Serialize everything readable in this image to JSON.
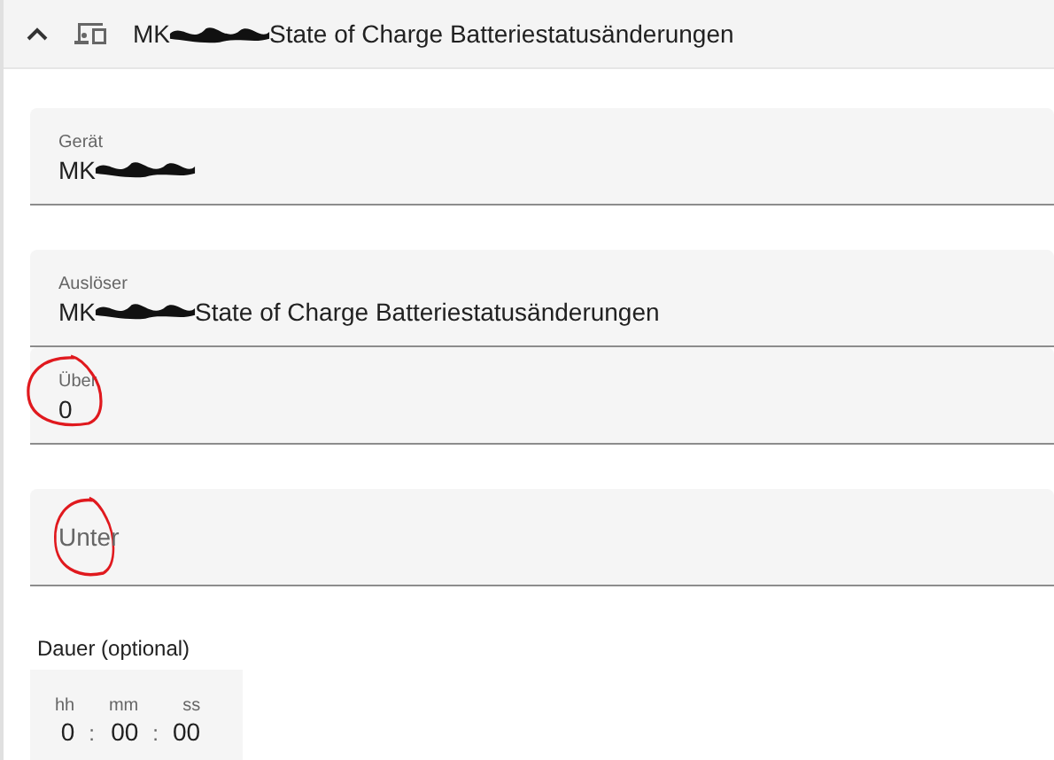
{
  "header": {
    "expanded": true,
    "title_start": "MK",
    "redacted": true,
    "title_end": "State of Charge Batteriestatusänderungen"
  },
  "fields": [
    {
      "label": "Gerät",
      "value": "MK",
      "redacted": true,
      "annotated": false
    },
    {
      "label": "Auslöser",
      "value": "MK",
      "redacted": true,
      "value_rest": "State of Charge Batteriestatusänderungen",
      "annotated": false
    },
    {
      "label": "Über",
      "value": "0",
      "redacted": false,
      "annotated": true
    },
    {
      "placeholder": "Unter",
      "annotated": true
    }
  ],
  "duration": {
    "label": "Dauer (optional)",
    "separator": ":",
    "units": [
      {
        "label": "hh",
        "value": "0"
      },
      {
        "label": "mm",
        "value": "00"
      },
      {
        "label": "ss",
        "value": "00"
      }
    ]
  }
}
